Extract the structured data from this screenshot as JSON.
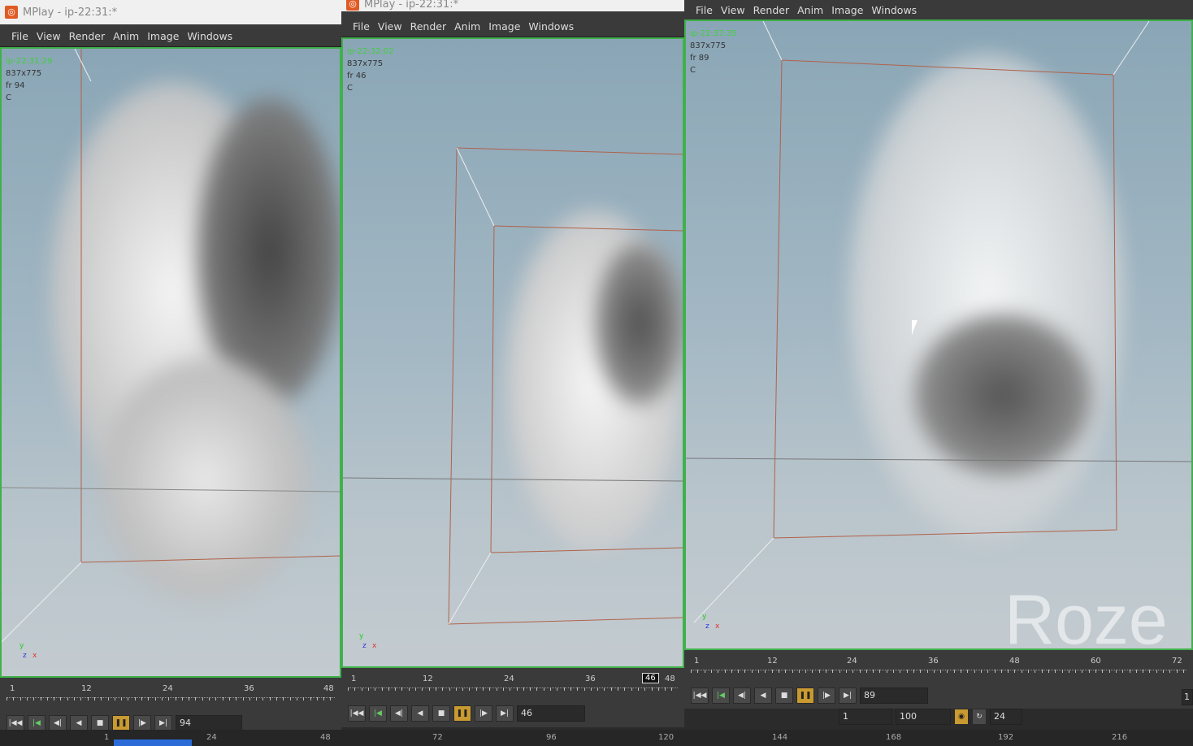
{
  "menu": [
    "File",
    "View",
    "Render",
    "Anim",
    "Image",
    "Windows"
  ],
  "windows": [
    {
      "title": "MPlay - ip-22:31:*",
      "info": {
        "name": "ip-22:31:29",
        "res": "837x775",
        "frame": "fr 94",
        "channel": "C"
      },
      "ruler_labels": [
        "1",
        "12",
        "24",
        "36",
        "48"
      ],
      "frame_value": "94"
    },
    {
      "title": "MPlay - ip-22:31:*",
      "info": {
        "name": "ip-22:32:02",
        "res": "837x775",
        "frame": "fr 46",
        "channel": "C"
      },
      "ruler_labels": [
        "1",
        "12",
        "24",
        "36",
        "48"
      ],
      "current_frame_marker": "46",
      "frame_value": "46",
      "range_hint": "100"
    },
    {
      "info": {
        "name": "ip-22:37:35",
        "res": "837x775",
        "frame": "fr 89",
        "channel": "C"
      },
      "ruler_labels": [
        "1",
        "12",
        "24",
        "36",
        "48",
        "60",
        "72"
      ],
      "frame_value": "89",
      "range_start": "1",
      "range_end": "100",
      "fps": "24",
      "edge_value": "1",
      "watermark": "Roze"
    }
  ],
  "bottom_ruler": [
    "1",
    "24",
    "48",
    "72",
    "96",
    "120",
    "144",
    "168",
    "192",
    "216"
  ],
  "axes": {
    "y": "y",
    "x": "x",
    "z": "z"
  },
  "colors": {
    "accent": "#c99a30",
    "viewport_border": "#3fb14a",
    "info_text": "#44cc44"
  }
}
